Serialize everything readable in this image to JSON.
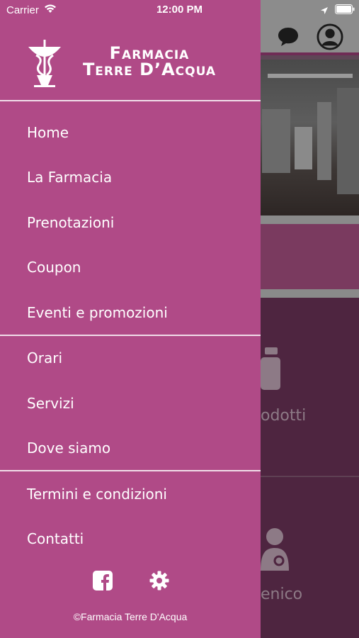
{
  "status_bar": {
    "carrier": "Carrier",
    "time": "12:00 PM"
  },
  "drawer": {
    "logo": {
      "line1": "Farmacia",
      "line2": "Terre D’Acqua"
    },
    "menu_group_1": [
      {
        "label": "Home"
      },
      {
        "label": "La Farmacia"
      },
      {
        "label": "Prenotazioni"
      },
      {
        "label": "Coupon"
      },
      {
        "label": "Eventi e promozioni"
      }
    ],
    "menu_group_2": [
      {
        "label": "Orari"
      },
      {
        "label": "Servizi"
      },
      {
        "label": "Dove siamo"
      }
    ],
    "menu_group_3": [
      {
        "label": "Termini e condizioni"
      },
      {
        "label": "Contatti"
      }
    ],
    "social_icons": [
      "facebook-icon",
      "gear-icon"
    ],
    "footer": "©Farmacia Terre D'Acqua"
  },
  "background_app": {
    "tile1_label_partial": "odotti",
    "tile2_label_partial": "enico"
  },
  "colors": {
    "drawer_bg": "#b04a87",
    "divider": "#f0dde9",
    "text": "#ffffff"
  }
}
